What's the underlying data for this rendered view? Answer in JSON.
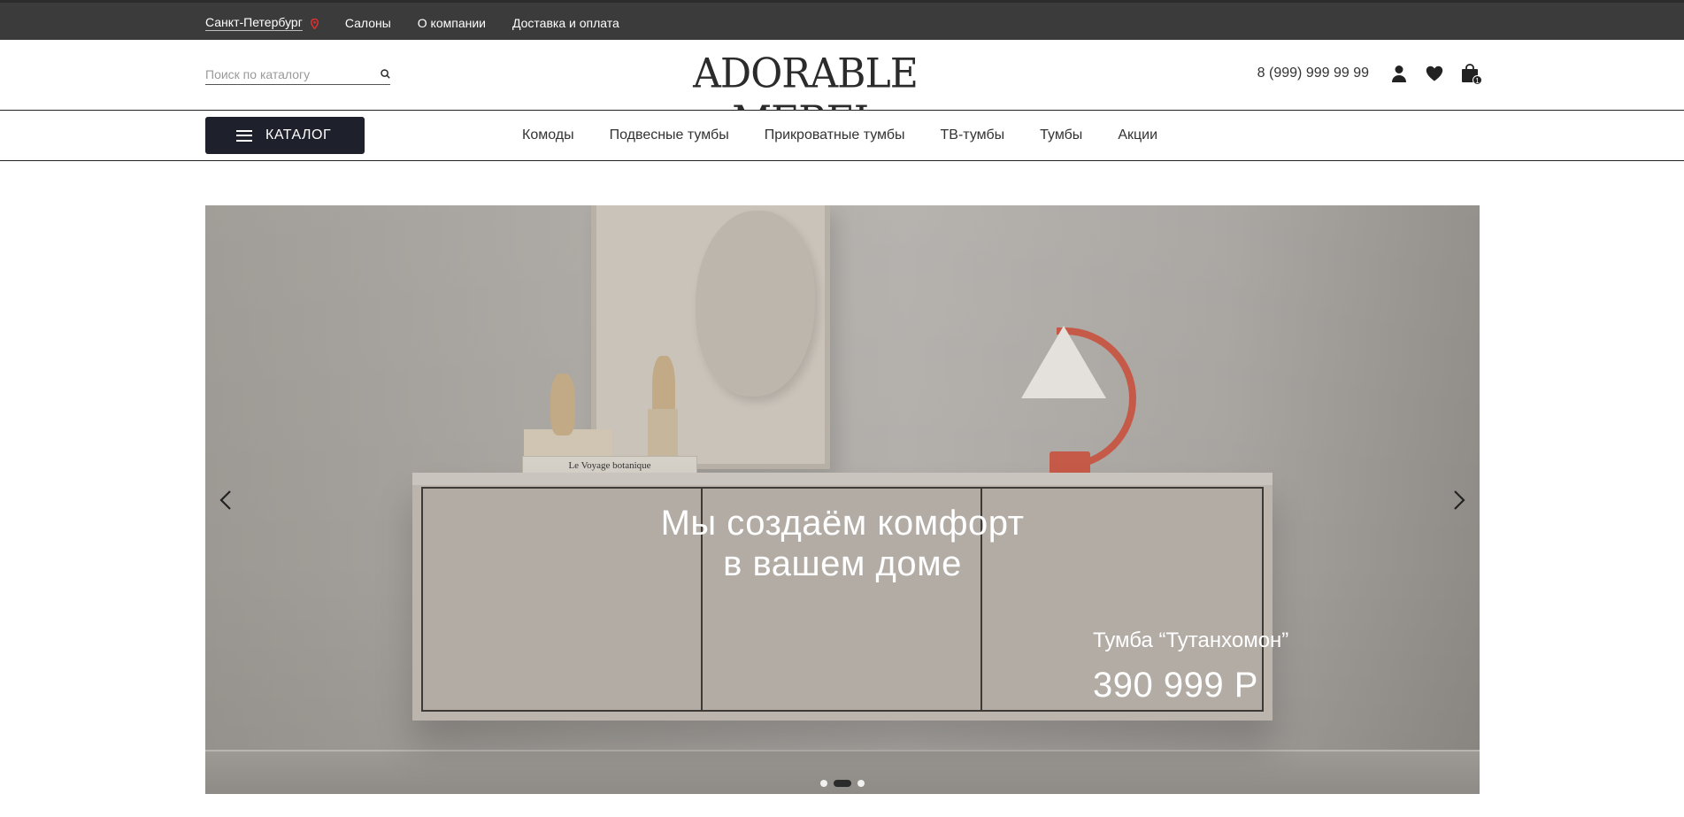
{
  "topbar": {
    "city": "Санкт-Петербург",
    "links": [
      "Салоны",
      "О компании",
      "Доставка и оплата"
    ],
    "icons": {
      "city": "location-pin-icon"
    },
    "accent_color": "#e0322f"
  },
  "header": {
    "search": {
      "placeholder": "Поиск по каталогу",
      "value": ""
    },
    "logo": "ADORABLE MEBEL",
    "phone": "8 (999) 999 99 99",
    "icons": [
      "user-icon",
      "heart-icon",
      "cart-icon"
    ],
    "cart_count": "1"
  },
  "nav": {
    "catalog_label": "КАТАЛОГ",
    "links": [
      "Комоды",
      "Подвесные тумбы",
      "Прикроватные тумбы",
      "ТВ-тумбы",
      "Тумбы",
      "Акции"
    ]
  },
  "hero": {
    "title_line1": "Мы создаём комфорт",
    "title_line2": "в вашем доме",
    "product_name": "Тумба “Тутанхомон”",
    "product_price": "390 999 Р",
    "book_title": "Le Voyage botanique",
    "slides_count": 3,
    "active_slide": 2
  },
  "colors": {
    "topbar_bg": "#3b3b3b",
    "catalog_btn_bg": "#1e202b",
    "lamp": "#c65a48"
  }
}
